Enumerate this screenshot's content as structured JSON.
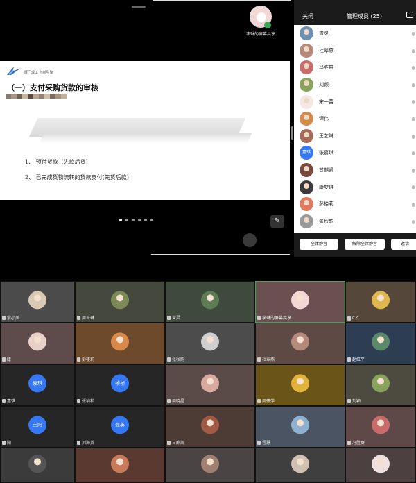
{
  "sharer": {
    "name": "李琳的屏幕共享"
  },
  "slide": {
    "school": "厦门理工 创新引擎",
    "title": "（一）支付采购货款的审核",
    "items": [
      "1、 预付货款（先款后货）",
      "2、 已完成货物流转的货款支付(先货后款)"
    ],
    "swatch_colors": [
      "#8b7b6a",
      "#a89480",
      "#6e5f50",
      "#c9b59d",
      "#5b4d41",
      "#b7a28b",
      "#928070",
      "#d1bfa7",
      "#7d6c5c",
      "#a5927d",
      "#c2b09a"
    ]
  },
  "slide_page": {
    "count": 6,
    "active": 0
  },
  "panel": {
    "close_label": "关闭",
    "title": "管理成员 (25)",
    "members": [
      {
        "name": "曾灵",
        "avatar_color": "#6c8fb2"
      },
      {
        "name": "杜翠燕",
        "avatar_color": "#b48a7a"
      },
      {
        "name": "冯胜群",
        "avatar_color": "#c96b6b"
      },
      {
        "name": "刘颖",
        "avatar_color": "#8aa35c"
      },
      {
        "name": "宋一蕾",
        "avatar_color": "#f4e7e4"
      },
      {
        "name": "谭伟",
        "avatar_color": "#d38b4a"
      },
      {
        "name": "王艺琳",
        "avatar_color": "#a56a5a"
      },
      {
        "name": "张嘉琪",
        "avatar_text": "嘉琪",
        "avatar_color": "#3478f6"
      },
      {
        "name": "甘麒凯",
        "avatar_color": "#7a4b3c"
      },
      {
        "name": "康梦琪",
        "avatar_color": "#3b3b3b"
      },
      {
        "name": "彭楼莉",
        "avatar_color": "#e07a5f"
      },
      {
        "name": "张秋韵",
        "avatar_color": "#999999"
      }
    ],
    "mute_all": "全体静音",
    "unmute_all": "解除全体静音",
    "invite": "邀请"
  },
  "tiles": [
    {
      "name": "俞小凤",
      "bg": "#4b4b4b",
      "avatar_color": "#d9c9b5"
    },
    {
      "name": "周玉琳",
      "bg": "#45483d",
      "avatar_color": "#7c8b55"
    },
    {
      "name": "曾灵",
      "bg": "#3e4a3c",
      "avatar_color": "#5f7d55"
    },
    {
      "name": "李琳的屏幕共享",
      "bg": "#6a5050",
      "avatar_color": "#f3d6d6",
      "active": true
    },
    {
      "name": "CZ",
      "bg": "#55483a",
      "avatar_color": "#e0b64e"
    },
    {
      "name": "滕",
      "bg": "#5e4c4c",
      "avatar_color": "#e8d0c8"
    },
    {
      "name": "彭楼莉",
      "bg": "#6e4a2c",
      "avatar_color": "#d98a4a"
    },
    {
      "name": "张秋韵",
      "bg": "#4c4c4c",
      "avatar_color": "#cfcfcf"
    },
    {
      "name": "杜翠燕",
      "bg": "#5e4a45",
      "avatar_color": "#b48a7a"
    },
    {
      "name": "赵红平",
      "bg": "#2d3d52",
      "avatar_color": "#5a8a6a"
    },
    {
      "name": "嘉琪",
      "bg": "#262626",
      "avatar_text": "嘉琪"
    },
    {
      "name": "张祯祯",
      "bg": "#262626",
      "avatar_text": "祯祯"
    },
    {
      "name": "周晓晶",
      "bg": "#5a4a48",
      "avatar_color": "#d9a9a0"
    },
    {
      "name": "周豪萍",
      "bg": "#6b5418",
      "avatar_color": "#e1b23c"
    },
    {
      "name": "刘颖",
      "bg": "#4d4a40",
      "avatar_color": "#8aa35c"
    },
    {
      "name": "阳",
      "bg": "#262626",
      "avatar_text": "王阳"
    },
    {
      "name": "刘海英",
      "bg": "#262626",
      "avatar_text": "海英"
    },
    {
      "name": "甘麒凯",
      "bg": "#4d3b36",
      "avatar_color": "#a05a46"
    },
    {
      "name": "程慧",
      "bg": "#4a5462",
      "avatar_color": "#8fb1d0"
    },
    {
      "name": "冯胜群",
      "bg": "#5e4848",
      "avatar_color": "#c96b6b"
    },
    {
      "name": "",
      "bg": "#3b3b3b",
      "avatar_color": "#555555"
    },
    {
      "name": "",
      "bg": "#5a3a30",
      "avatar_color": "#c87a5a"
    },
    {
      "name": "",
      "bg": "#4a4444",
      "avatar_color": "#a08070"
    },
    {
      "name": "",
      "bg": "#3f3f3f",
      "avatar_color": "#d0c0b0"
    },
    {
      "name": "",
      "bg": "#4d4040",
      "avatar_color": "#f0e0e0"
    }
  ]
}
